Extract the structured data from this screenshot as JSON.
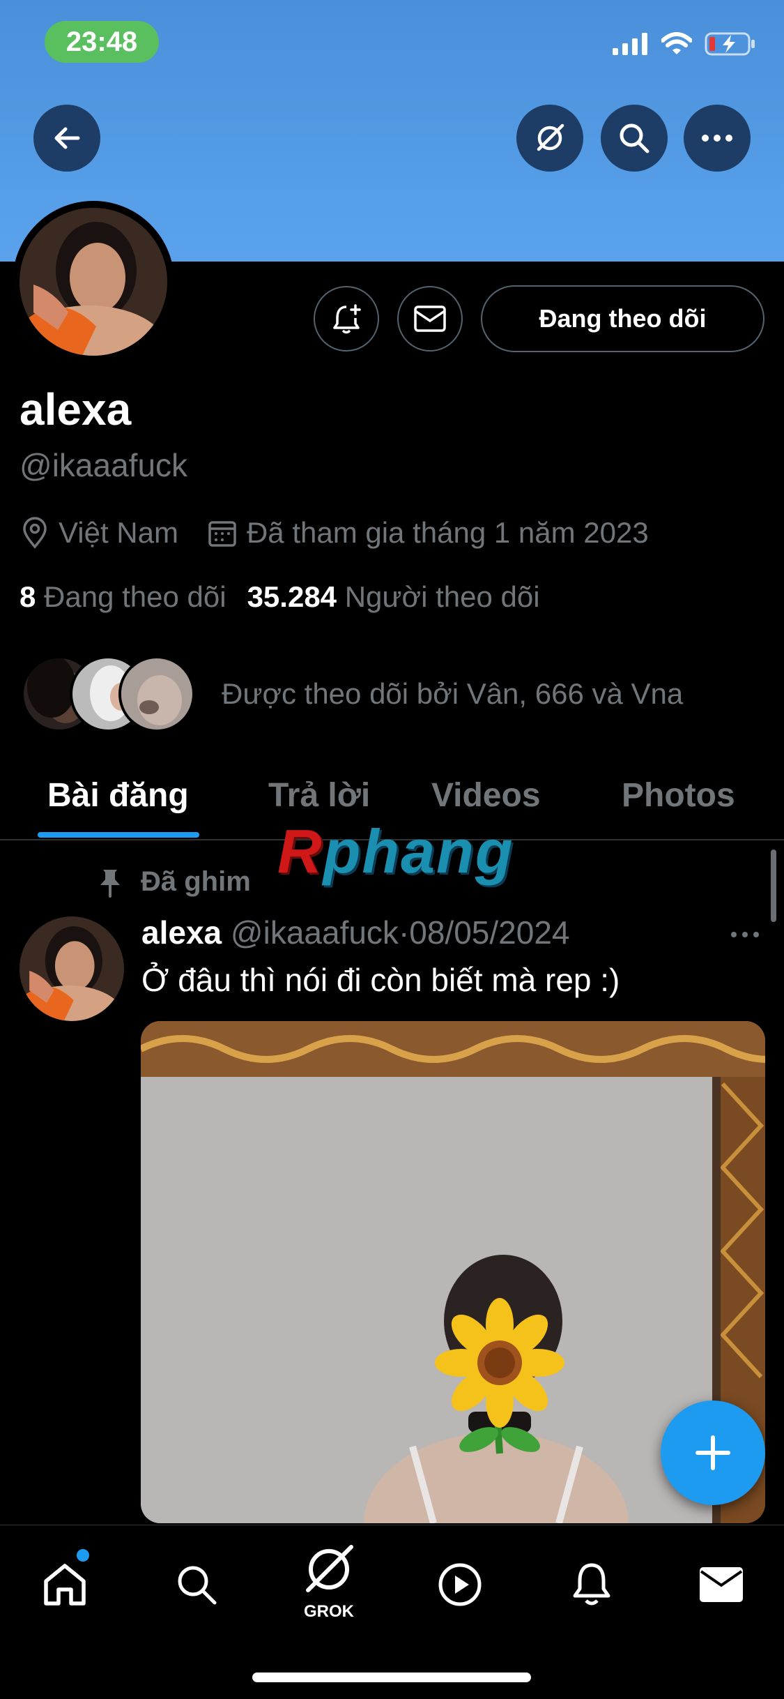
{
  "status_bar": {
    "time": "23:48"
  },
  "header": {
    "back_icon": "arrow-left-icon",
    "grok_icon": "grok-icon",
    "search_icon": "search-icon",
    "more_icon": "ellipsis-icon"
  },
  "profile": {
    "display_name": "alexa",
    "handle": "@ikaaafuck",
    "location": "Việt Nam",
    "joined": "Đã tham gia tháng 1 năm 2023",
    "following_count": "8",
    "following_label": "Đang theo dõi",
    "followers_count": "35.284",
    "followers_label": "Người theo dõi",
    "followed_by": "Được theo dõi bởi Vân, 666 và Vna",
    "follow_button": "Đang theo dõi"
  },
  "tabs": [
    {
      "label": "Bài đăng",
      "active": true
    },
    {
      "label": "Trả lời",
      "active": false
    },
    {
      "label": "Videos",
      "active": false
    },
    {
      "label": "Photos",
      "active": false
    }
  ],
  "watermark": {
    "first": "R",
    "rest": "phang"
  },
  "post": {
    "pinned_label": "Đã ghim",
    "name": "alexa",
    "handle": "@ikaaafuck",
    "separator": "·",
    "date": "08/05/2024",
    "text": "Ở đâu thì nói đi còn biết mà rep :)"
  },
  "bottom_nav": {
    "grok_label": "GROK",
    "items": [
      "home-icon",
      "search-icon",
      "grok-icon",
      "play-icon",
      "bell-icon",
      "mail-icon"
    ]
  },
  "colors": {
    "accent": "#1d9bf0",
    "banner": "#4a8fd9",
    "muted": "#71767b"
  }
}
